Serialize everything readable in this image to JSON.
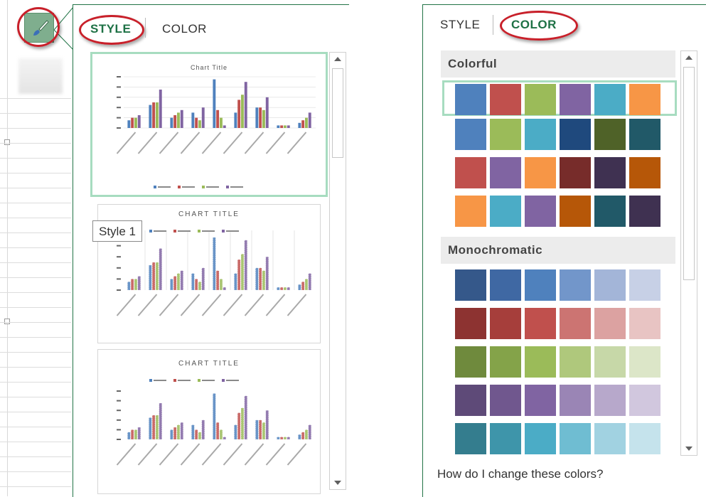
{
  "style_panel": {
    "tabs": {
      "style": "STYLE",
      "color": "COLOR"
    },
    "tooltip": "Style 1",
    "thumbnails": [
      {
        "title": "Chart Title",
        "selected": true
      },
      {
        "title": "CHART TITLE",
        "selected": false
      },
      {
        "title": "CHART TITLE",
        "selected": false
      }
    ]
  },
  "color_panel": {
    "tabs": {
      "style": "STYLE",
      "color": "COLOR"
    },
    "sections": [
      {
        "title": "Colorful",
        "palettes": [
          [
            "#4F81BD",
            "#C0504D",
            "#9BBB59",
            "#8064A2",
            "#4BACC6",
            "#F79646"
          ],
          [
            "#4F81BD",
            "#9BBB59",
            "#4BACC6",
            "#1F497D",
            "#4F6228",
            "#215968"
          ],
          [
            "#C0504D",
            "#8064A2",
            "#F79646",
            "#772C2A",
            "#3F3151",
            "#B65708"
          ],
          [
            "#F79646",
            "#4BACC6",
            "#8064A2",
            "#B65708",
            "#215968",
            "#3F3151"
          ]
        ]
      },
      {
        "title": "Monochromatic",
        "palettes": [
          [
            "#35588A",
            "#3F68A3",
            "#4F81BD",
            "#7296CA",
            "#A3B5D8",
            "#C7D0E6"
          ],
          [
            "#8D3331",
            "#A63E3B",
            "#C0504D",
            "#CC7472",
            "#DCA2A1",
            "#E8C4C3"
          ],
          [
            "#6F8A3D",
            "#84A349",
            "#9BBB59",
            "#AFC87C",
            "#C7D8A8",
            "#DCE6C8"
          ],
          [
            "#5E4A78",
            "#70578E",
            "#8064A2",
            "#9A85B5",
            "#B7A8CB",
            "#D1C7DE"
          ],
          [
            "#347D8E",
            "#3E95AA",
            "#4BACC6",
            "#6FBDD2",
            "#A1D2E1",
            "#C5E3EC"
          ]
        ]
      }
    ],
    "help_link": "How do I change these colors?"
  },
  "colors": {
    "accent_green": "#217346",
    "highlight_green": "#A7DCC0",
    "annotation_red": "#C8202A"
  },
  "icons": {
    "chart_styles": "paintbrush-icon"
  }
}
